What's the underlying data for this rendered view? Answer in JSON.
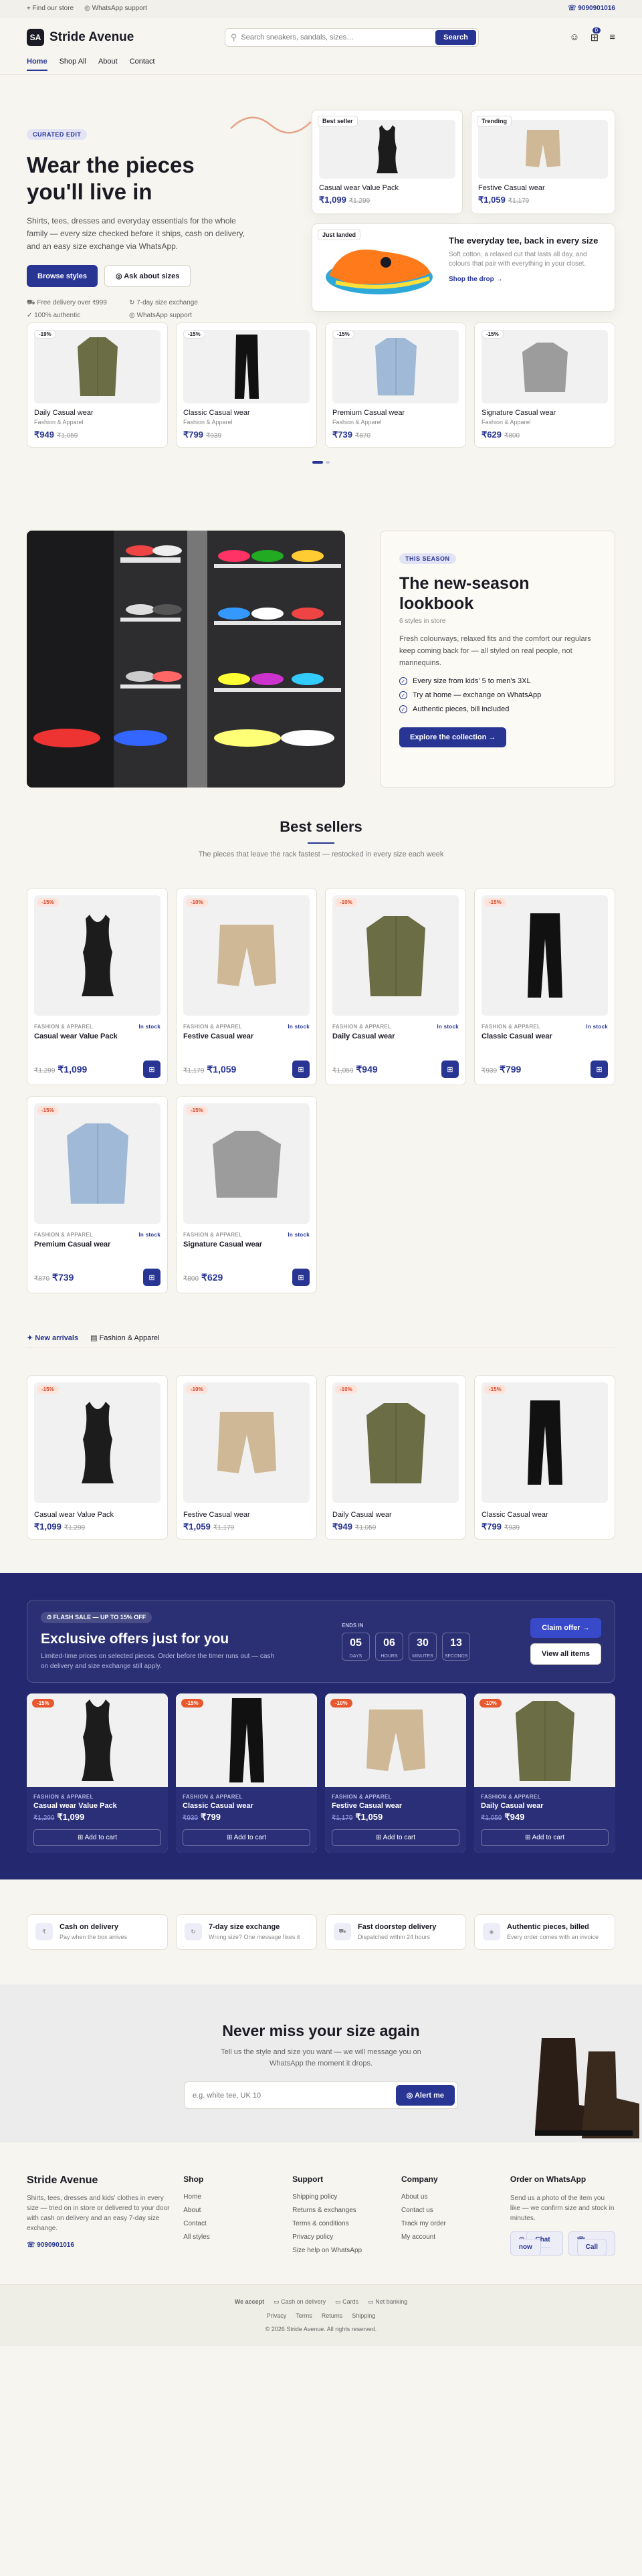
{
  "topbar": {
    "find": "Find our store",
    "wa": "WhatsApp support",
    "phone": "9090901016"
  },
  "header": {
    "logo": "Stride Avenue",
    "search_placeholder": "Search sneakers, sandals, sizes…",
    "search_btn": "Search",
    "cart_count": "0"
  },
  "nav": [
    "Home",
    "Shop All",
    "About",
    "Contact"
  ],
  "hero": {
    "eyebrow": "CURATED EDIT",
    "title": "Wear the pieces you'll live in",
    "lead": "Shirts, tees, dresses and everyday essentials for the whole family — every size checked before it ships, cash on delivery, and an easy size exchange via WhatsApp.",
    "cta1": "Browse styles",
    "cta2": "Ask about sizes",
    "perks": [
      "Free delivery over ₹999",
      "7-day size exchange",
      "100% authentic",
      "WhatsApp support"
    ],
    "card1": {
      "tag": "Best seller",
      "name": "Casual wear Value Pack",
      "price": "₹1,099",
      "old": "₹1,299"
    },
    "card2": {
      "tag": "Trending",
      "name": "Festive Casual wear",
      "price": "₹1,059",
      "old": "₹1,179"
    },
    "feature": {
      "tag": "Just landed",
      "title": "The everyday tee, back in every size",
      "text": "Soft cotton, a relaxed cut that lasts all day, and colours that pair with everything in your closet.",
      "link": "Shop the drop"
    }
  },
  "strip": [
    {
      "disc": "-19%",
      "name": "Daily Casual wear",
      "cat": "Fashion & Apparel",
      "price": "₹949",
      "old": "₹1,059"
    },
    {
      "disc": "-15%",
      "name": "Classic Casual wear",
      "cat": "Fashion & Apparel",
      "price": "₹799",
      "old": "₹939"
    },
    {
      "disc": "-15%",
      "name": "Premium Casual wear",
      "cat": "Fashion & Apparel",
      "price": "₹739",
      "old": "₹870"
    },
    {
      "disc": "-15%",
      "name": "Signature Casual wear",
      "cat": "Fashion & Apparel",
      "price": "₹629",
      "old": "₹800"
    }
  ],
  "lookbook": {
    "tag": "THIS SEASON",
    "title": "The new-season lookbook",
    "sub": "6 styles in store",
    "text": "Fresh colourways, relaxed fits and the comfort our regulars keep coming back for — all styled on real people, not mannequins.",
    "points": [
      "Every size from kids' 5 to men's 3XL",
      "Try at home — exchange on WhatsApp",
      "Authentic pieces, bill included"
    ],
    "cta": "Explore the collection"
  },
  "bestsellers": {
    "title": "Best sellers",
    "sub": "The pieces that leave the rack fastest — restocked in every size each week",
    "items": [
      {
        "disc": "-15%",
        "cat": "FASHION & APPAREL",
        "stock": "In stock",
        "name": "Casual wear Value Pack",
        "price": "₹1,099",
        "old": "₹1,299"
      },
      {
        "disc": "-10%",
        "cat": "FASHION & APPAREL",
        "stock": "In stock",
        "name": "Festive Casual wear",
        "price": "₹1,059",
        "old": "₹1,179"
      },
      {
        "disc": "-10%",
        "cat": "FASHION & APPAREL",
        "stock": "In stock",
        "name": "Daily Casual wear",
        "price": "₹949",
        "old": "₹1,059"
      },
      {
        "disc": "-15%",
        "cat": "FASHION & APPAREL",
        "stock": "In stock",
        "name": "Classic Casual wear",
        "price": "₹799",
        "old": "₹939"
      },
      {
        "disc": "-15%",
        "cat": "FASHION & APPAREL",
        "stock": "In stock",
        "name": "Premium Casual wear",
        "price": "₹739",
        "old": "₹870"
      },
      {
        "disc": "-15%",
        "cat": "FASHION & APPAREL",
        "stock": "In stock",
        "name": "Signature Casual wear",
        "price": "₹629",
        "old": "₹800"
      }
    ]
  },
  "tabs": [
    "New arrivals",
    "Fashion & Apparel"
  ],
  "arrivals": [
    {
      "disc": "-15%",
      "name": "Casual wear Value Pack",
      "price": "₹1,099",
      "old": "₹1,299"
    },
    {
      "disc": "-10%",
      "name": "Festive Casual wear",
      "price": "₹1,059",
      "old": "₹1,179"
    },
    {
      "disc": "-10%",
      "name": "Daily Casual wear",
      "price": "₹949",
      "old": "₹1,059"
    },
    {
      "disc": "-15%",
      "name": "Classic Casual wear",
      "price": "₹799",
      "old": "₹939"
    }
  ],
  "flash": {
    "tag": "FLASH SALE — UP TO 15% OFF",
    "title": "Exclusive offers just for you",
    "text": "Limited-time prices on selected pieces. Order before the timer runs out — cash on delivery and size exchange still apply.",
    "ends": "ENDS IN",
    "count": [
      {
        "v": "05",
        "l": "DAYS"
      },
      {
        "v": "06",
        "l": "HOURS"
      },
      {
        "v": "30",
        "l": "MINUTES"
      },
      {
        "v": "13",
        "l": "SECONDS"
      }
    ],
    "claim": "Claim offer",
    "view": "View all items",
    "atc": "Add to cart",
    "items": [
      {
        "disc": "-15%",
        "cat": "FASHION & APPAREL",
        "name": "Casual wear Value Pack",
        "price": "₹1,099",
        "old": "₹1,299"
      },
      {
        "disc": "-15%",
        "cat": "FASHION & APPAREL",
        "name": "Classic Casual wear",
        "price": "₹799",
        "old": "₹939"
      },
      {
        "disc": "-10%",
        "cat": "FASHION & APPAREL",
        "name": "Festive Casual wear",
        "price": "₹1,059",
        "old": "₹1,179"
      },
      {
        "disc": "-10%",
        "cat": "FASHION & APPAREL",
        "name": "Daily Casual wear",
        "price": "₹949",
        "old": "₹1,059"
      }
    ]
  },
  "benefits": [
    {
      "t": "Cash on delivery",
      "s": "Pay when the box arrives"
    },
    {
      "t": "7-day size exchange",
      "s": "Wrong size? One message fixes it"
    },
    {
      "t": "Fast doorstep delivery",
      "s": "Dispatched within 24 hours"
    },
    {
      "t": "Authentic pieces, billed",
      "s": "Every order comes with an invoice"
    }
  ],
  "newsletter": {
    "title": "Never miss your size again",
    "text": "Tell us the style and size you want — we will message you on WhatsApp the moment it drops.",
    "placeholder": "e.g. white tee, UK 10",
    "btn": "Alert me"
  },
  "footer": {
    "brand": "Stride Avenue",
    "about": "Shirts, tees, dresses and kids' clothes in every size — tried on in store or delivered to your door with cash on delivery and an easy 7-day size exchange.",
    "phone": "9090901016",
    "cols": [
      {
        "h": "Shop",
        "items": [
          "Home",
          "About",
          "Contact",
          "All styles"
        ]
      },
      {
        "h": "Support",
        "items": [
          "Shipping policy",
          "Returns & exchanges",
          "Terms & conditions",
          "Privacy policy",
          "Size help on WhatsApp"
        ]
      },
      {
        "h": "Company",
        "items": [
          "About us",
          "Contact us",
          "Track my order",
          "My account"
        ]
      }
    ],
    "wa_title": "Order on WhatsApp",
    "wa_text": "Send us a photo of the item you like — we confirm size and stock in minutes.",
    "chat": "Chat now",
    "call": "Call",
    "accept": "We accept",
    "pay": [
      "Cash on delivery",
      "Cards",
      "Net banking"
    ],
    "legal": [
      "Privacy",
      "Terms",
      "Returns",
      "Shipping"
    ],
    "copy": "© 2026 Stride Avenue. All rights reserved."
  }
}
